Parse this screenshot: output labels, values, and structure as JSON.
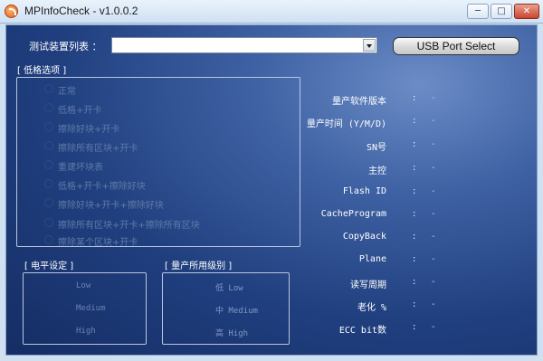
{
  "window": {
    "title": "MPInfoCheck - v1.0.0.2",
    "minimize_label": "─",
    "maximize_label": "□",
    "close_label": "✕"
  },
  "device": {
    "label": "测试装置列表 ：",
    "selected": "",
    "usb_button": "USB Port Select"
  },
  "format_options": {
    "group_label": "[ 低格选项 ]",
    "items": [
      "正常",
      "低格+开卡",
      "擦除好块+开卡",
      "擦除所有区块+开卡",
      "重建坏块表",
      "低格+开卡+擦除好块",
      "擦除好块+开卡+擦除好块",
      "擦除所有区块+开卡+擦除所有区块",
      "擦除某个区块+开卡"
    ]
  },
  "voltage": {
    "group_label": "[ 电平设定 ]",
    "items": [
      "Low",
      "Medium",
      "High"
    ]
  },
  "level": {
    "group_label": "[ 量产所用级别 ]",
    "items": [
      "低 Low",
      "中 Medium",
      "高 High"
    ]
  },
  "info": {
    "rows": [
      {
        "label": "量产软件版本",
        "value": "-"
      },
      {
        "label": "量产时间 (Y/M/D)",
        "value": "-"
      },
      {
        "label": "SN号",
        "value": "-"
      },
      {
        "label": "主控",
        "value": "-"
      },
      {
        "label": "Flash ID",
        "value": "-"
      },
      {
        "label": "CacheProgram",
        "value": "-"
      },
      {
        "label": "CopyBack",
        "value": "-"
      },
      {
        "label": "Plane",
        "value": "-"
      },
      {
        "label": "读写周期",
        "value": "-"
      },
      {
        "label": "老化 %",
        "value": "-"
      },
      {
        "label": "ECC bit数",
        "value": "-"
      }
    ],
    "colon": ":"
  }
}
